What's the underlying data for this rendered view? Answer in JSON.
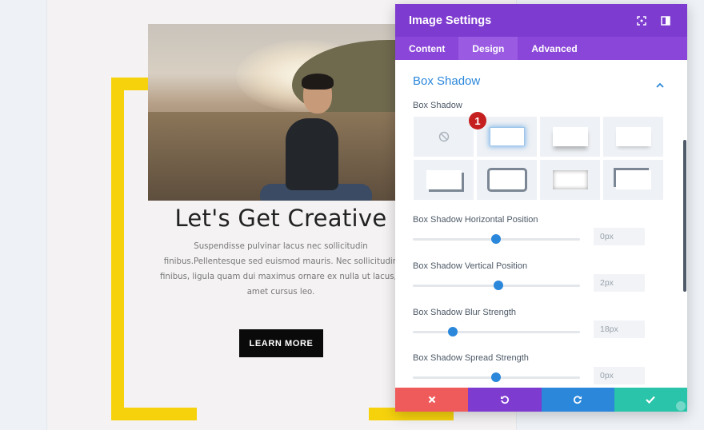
{
  "page": {
    "heading": "Let's Get Creative",
    "body_lines": [
      "Suspendisse pulvinar lacus nec sollicitudin",
      "finibus.Pellentesque sed euismod mauris. Nec sollicitudin",
      "finibus, ligula quam dui maximus ornare ex nulla ut lacus, sit",
      "amet cursus leo."
    ],
    "button_label": "LEARN MORE",
    "frame_color": "#f6d20d"
  },
  "modal": {
    "title": "Image Settings",
    "header_icons": [
      "fullscreen-icon",
      "sidebar-toggle-icon"
    ],
    "tabs": [
      {
        "label": "Content",
        "active": false
      },
      {
        "label": "Design",
        "active": true
      },
      {
        "label": "Advanced",
        "active": false
      }
    ],
    "section": {
      "title": "Box Shadow",
      "expanded": true
    },
    "box_shadow_field_label": "Box Shadow",
    "presets": [
      {
        "name": "none",
        "selected": false
      },
      {
        "name": "soft-all-sides",
        "selected": true
      },
      {
        "name": "bottom-shadow",
        "selected": false
      },
      {
        "name": "soft-bottom",
        "selected": false
      },
      {
        "name": "bottom-right-hard",
        "selected": false
      },
      {
        "name": "inset-border",
        "selected": false
      },
      {
        "name": "inset-soft",
        "selected": false
      },
      {
        "name": "top-left-hard",
        "selected": false
      }
    ],
    "marker_number": "1",
    "sliders": [
      {
        "label": "Box Shadow Horizontal Position",
        "value": "0px",
        "level": 0.5
      },
      {
        "label": "Box Shadow Vertical Position",
        "value": "2px",
        "level": 0.51
      },
      {
        "label": "Box Shadow Blur Strength",
        "value": "18px",
        "level": 0.24
      },
      {
        "label": "Box Shadow Spread Strength",
        "value": "0px",
        "level": 0.5
      }
    ],
    "footer_buttons": [
      {
        "name": "discard",
        "icon": "close-icon",
        "color": "#ef5a5a"
      },
      {
        "name": "undo",
        "icon": "undo-icon",
        "color": "#7e3bd0"
      },
      {
        "name": "redo",
        "icon": "redo-icon",
        "color": "#2b87da"
      },
      {
        "name": "save",
        "icon": "check-icon",
        "color": "#29c4a9"
      }
    ],
    "colors": {
      "header": "#7e3bd0",
      "tabs": "#8a46d8",
      "accent": "#2b87da"
    }
  }
}
